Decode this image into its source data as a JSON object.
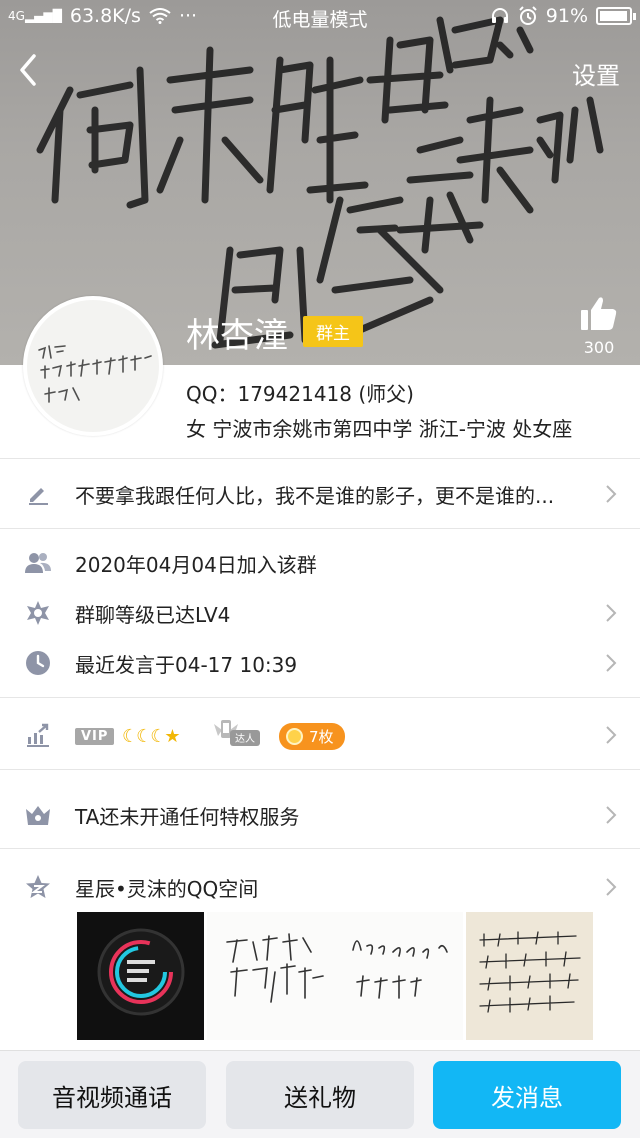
{
  "status_bar": {
    "network": "4G",
    "speed": "63.8K/s",
    "more": "···",
    "mode": "低电量模式",
    "battery": "91%"
  },
  "header": {
    "settings_label": "设置",
    "like_count": "300"
  },
  "profile": {
    "name": "林杏潼",
    "role_badge": "群主",
    "qq_line": "QQ：179421418 (师父)",
    "info_line": "女  宁波市余姚市第四中学  浙江-宁波  处女座"
  },
  "rows": {
    "signature": "不要拿我跟任何人比，我不是谁的影子，更不是谁的...",
    "joined": "2020年04月04日加入该群",
    "level": "群聊等级已达LV4",
    "last_speak": "最近发言于04-17 10:39",
    "privilege": "TA还未开通任何特权服务",
    "qzone": "星辰•灵沫的QQ空间"
  },
  "badges": {
    "vip": "VIP",
    "expert": "达人",
    "count": "7枚"
  },
  "bottom_bar": {
    "call": "音视频通话",
    "gift": "送礼物",
    "message": "发消息"
  },
  "colors": {
    "accent": "#12b7f5",
    "badge_yellow": "#f5c518",
    "badge_orange": "#f7931e",
    "icon_gray": "#8e94a7"
  }
}
